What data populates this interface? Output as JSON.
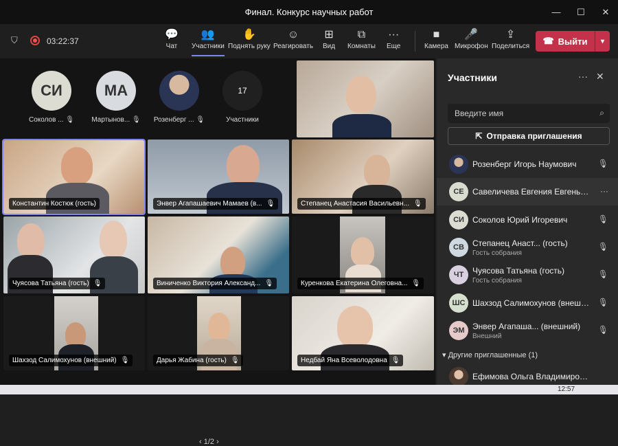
{
  "window": {
    "title": "Финал. Конкурс научных работ"
  },
  "toolbar": {
    "timer": "03:22:37",
    "buttons": [
      {
        "label": "Чат",
        "icon": "chat-icon"
      },
      {
        "label": "Участники",
        "icon": "people-icon"
      },
      {
        "label": "Поднять руку",
        "icon": "hand-icon"
      },
      {
        "label": "Реагировать",
        "icon": "smile-icon"
      },
      {
        "label": "Вид",
        "icon": "grid-icon"
      },
      {
        "label": "Комнаты",
        "icon": "rooms-icon"
      },
      {
        "label": "Еще",
        "icon": "more-icon"
      },
      {
        "label": "Камера",
        "icon": "camera-icon"
      },
      {
        "label": "Микрофон",
        "icon": "mic-icon"
      },
      {
        "label": "Поделиться",
        "icon": "share-icon"
      }
    ],
    "leave_label": "Выйти"
  },
  "avatars": [
    {
      "initials": "СИ",
      "name": "Соколов ...",
      "color": "#dcdcd3"
    },
    {
      "initials": "МА",
      "name": "Мартынов...",
      "color": "#d8dce0"
    },
    {
      "initials": "",
      "name": "Розенберг ...",
      "color": "#8a6d5b"
    },
    {
      "initials": "17",
      "name": "Участники",
      "color": "#202020"
    }
  ],
  "tiles": [
    {
      "label": "Константин Костюк (гость)",
      "muted": false
    },
    {
      "label": "Энвер Агапашаевич Мамаев (в...",
      "muted": true
    },
    {
      "label": "Степанец Анастасия Васильевн...",
      "muted": true
    },
    {
      "label": "Чуясова Татьяна (гость)",
      "muted": true
    },
    {
      "label": "Виниченко Виктория Александ...",
      "muted": true
    },
    {
      "label": "Куренкова Екатерина Олеговна...",
      "muted": true
    },
    {
      "label": "Шахзод Салимохунов (внешний)",
      "muted": true
    },
    {
      "label": "Дарья Жабина (гость)",
      "muted": true
    },
    {
      "label": "Недбай Яна Всеволодовна",
      "muted": true
    }
  ],
  "pager": "1/2",
  "panel": {
    "title": "Участники",
    "search_placeholder": "Введите имя",
    "invite_label": "Отправка приглашения",
    "participants": [
      {
        "initials": "",
        "name": "Розенберг Игорь Наумович",
        "sub": "",
        "color": "#8a6d5b"
      },
      {
        "initials": "СЕ",
        "name": "Савеличева Евгения Евгеньев...",
        "sub": "",
        "color": "#d9ddd0"
      },
      {
        "initials": "СИ",
        "name": "Соколов Юрий Игоревич",
        "sub": "",
        "color": "#dcdcd3"
      },
      {
        "initials": "СВ",
        "name": "Степанец Анаст...  (гость)",
        "sub": "Гость собрания",
        "color": "#cfd8e0"
      },
      {
        "initials": "ЧТ",
        "name": "Чуясова Татьяна (гость)",
        "sub": "Гость собрания",
        "color": "#d8d0e0"
      },
      {
        "initials": "ШС",
        "name": "Шахзод Салимохунов (внешний)",
        "sub": "",
        "color": "#d6e0cf"
      },
      {
        "initials": "ЭМ",
        "name": "Энвер Агапаша...  (внешний)",
        "sub": "Внешний",
        "color": "#e6c9c9"
      }
    ],
    "others_label": "Другие приглашенные (1)",
    "invited": [
      {
        "name": "Ефимова Ольга Владимировна"
      }
    ]
  },
  "taskbar": {
    "clock": "12:57"
  }
}
